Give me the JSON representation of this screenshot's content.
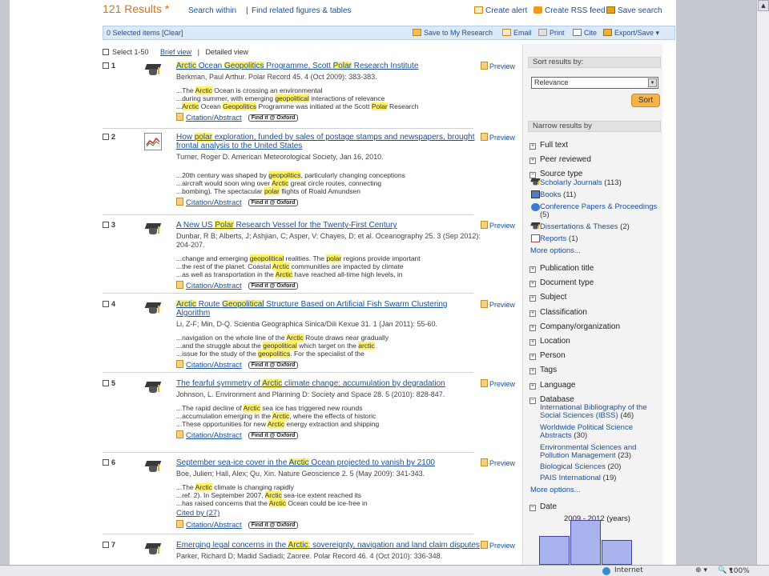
{
  "header": {
    "results_count": "121 Results *",
    "search_within": "Search within",
    "separator": "|",
    "find_related": "Find related figures & tables",
    "create_alert": "Create alert",
    "create_rss": "Create RSS feed",
    "save_search": "Save search"
  },
  "selection_bar": {
    "selected": "0 Selected items [Clear]",
    "save_to_my_research": "Save to My Research",
    "email": "Email",
    "print": "Print",
    "cite": "Cite",
    "export_save": "Export/Save"
  },
  "view": {
    "select_range": "Select 1-50",
    "brief_view": "Brief view",
    "separator": "|",
    "detailed_view": "Detailed view"
  },
  "results": [
    {
      "num": "1",
      "meta": "Berkman, Paul Arthur. Polar Record 45. 4  (Oct 2009): 383-383.",
      "links_label": "Citation/Abstract",
      "preview": "Preview"
    },
    {
      "num": "2",
      "meta": "Turner, Roger D. American Meteorological Society, Jan 16, 2010.",
      "links_label": "Citation/Abstract",
      "preview": "Preview"
    },
    {
      "num": "3",
      "meta": "Dunbar, R B; Alberts, J; Ashjian, C; Asper, V; Chayes, D; et al. Oceanography 25. 3  (Sep 2012): 204-207.",
      "links_label": "Citation/Abstract",
      "preview": "Preview"
    },
    {
      "num": "4",
      "meta": "Li, Z-F; Min, D-Q. Scientia Geographica Sinica/Dili Kexue 31. 1  (Jan 2011): 55-60.",
      "links_label": "Citation/Abstract",
      "preview": "Preview"
    },
    {
      "num": "5",
      "meta": "Johnson, L. Environment and Planning D: Society and Space 28. 5  (2010): 828-847.",
      "links_label": "Citation/Abstract",
      "preview": "Preview"
    },
    {
      "num": "6",
      "meta": "Boe, Julien; Hall, Alex; Qu, Xin. Nature Geoscience 2. 5  (May 2009): 341-343.",
      "links_label": "Citation/Abstract",
      "cited_by": "Cited by (27)",
      "preview": "Preview"
    },
    {
      "num": "7",
      "meta": "Parker, Richard D; Madid Sadiadi; Zaoree. Polar Record 46. 4  (Oct 2010): 336-348.",
      "preview": "Preview"
    }
  ],
  "find_it_label": "Find it @ Oxford",
  "sidebar": {
    "collapse": "▸▸",
    "sort_header": "Sort results by:",
    "sort_value": "Relevance",
    "sort_button": "Sort",
    "narrow_header": "Narrow results by",
    "facets": {
      "full_text": "Full text",
      "peer_reviewed": "Peer reviewed",
      "source_type": "Source type",
      "publication_title": "Publication title",
      "document_type": "Document type",
      "subject": "Subject",
      "classification": "Classification",
      "company": "Company/organization",
      "location": "Location",
      "person": "Person",
      "tags": "Tags",
      "language": "Language",
      "database": "Database",
      "date": "Date"
    },
    "source_types": [
      {
        "label": "Scholarly Journals",
        "count": "(113)"
      },
      {
        "label": "Books",
        "count": "(11)"
      },
      {
        "label": "Conference Papers & Proceedings",
        "count": "(5)"
      },
      {
        "label": "Dissertations & Theses",
        "count": "(2)"
      },
      {
        "label": "Reports",
        "count": "(1)"
      }
    ],
    "databases": [
      {
        "label": "International Bibliography of the Social Sciences (IBSS)",
        "count": "(46)"
      },
      {
        "label": "Worldwide Political Science Abstracts",
        "count": "(30)"
      },
      {
        "label": "Environmental Sciences and Pollution Management",
        "count": "(23)"
      },
      {
        "label": "Biological Sciences",
        "count": "(20)"
      },
      {
        "label": "PAIS International",
        "count": "(19)"
      }
    ],
    "more_options": "More options...",
    "date_range": "2009 - 2012 (years)",
    "date_histogram_levels": [
      0.65,
      1.0,
      0.55
    ]
  },
  "statusbar": {
    "zone": "Internet",
    "zoom": "100%"
  },
  "colors": {
    "highlight": "#fff26b",
    "link": "#1b4f9c",
    "accent": "#d9730f"
  }
}
